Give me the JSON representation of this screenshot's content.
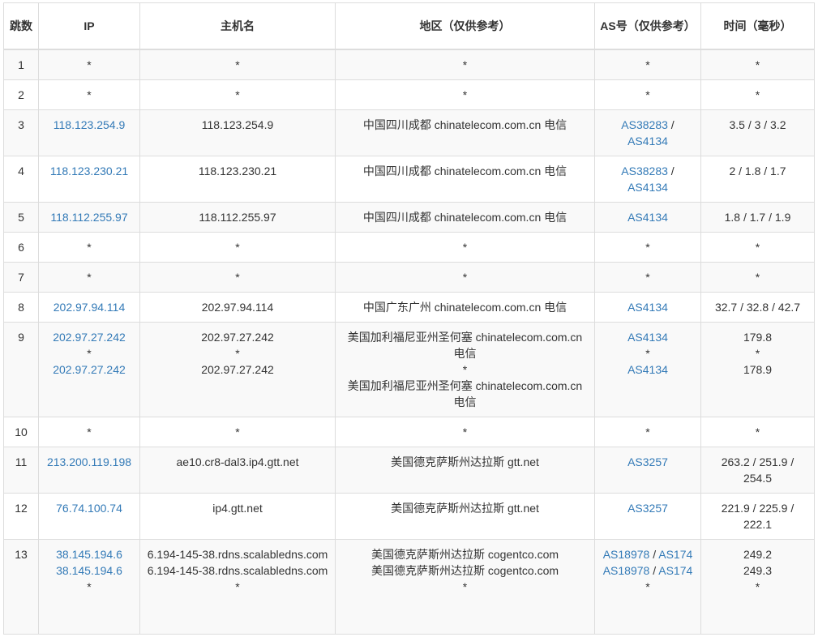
{
  "headers": {
    "hop": "跳数",
    "ip": "IP",
    "host": "主机名",
    "region": "地区（仅供参考）",
    "as": "AS号（仅供参考）",
    "time": "时间（毫秒）"
  },
  "rows": [
    {
      "hop": "1",
      "ip": [
        "*"
      ],
      "host": [
        "*"
      ],
      "region": [
        "*"
      ],
      "as": [
        "*"
      ],
      "time": [
        "*"
      ]
    },
    {
      "hop": "2",
      "ip": [
        "*"
      ],
      "host": [
        "*"
      ],
      "region": [
        "*"
      ],
      "as": [
        "*"
      ],
      "time": [
        "*"
      ]
    },
    {
      "hop": "3",
      "ip": [
        "118.123.254.9"
      ],
      "host": [
        "118.123.254.9"
      ],
      "region": [
        "中国四川成都 chinatelecom.com.cn 电信"
      ],
      "as": [
        "AS38283 / AS4134"
      ],
      "time": [
        "3.5 / 3 / 3.2"
      ]
    },
    {
      "hop": "4",
      "ip": [
        "118.123.230.21"
      ],
      "host": [
        "118.123.230.21"
      ],
      "region": [
        "中国四川成都 chinatelecom.com.cn 电信"
      ],
      "as": [
        "AS38283 / AS4134"
      ],
      "time": [
        "2 / 1.8 / 1.7"
      ]
    },
    {
      "hop": "5",
      "ip": [
        "118.112.255.97"
      ],
      "host": [
        "118.112.255.97"
      ],
      "region": [
        "中国四川成都 chinatelecom.com.cn 电信"
      ],
      "as": [
        "AS4134"
      ],
      "time": [
        "1.8 / 1.7 / 1.9"
      ]
    },
    {
      "hop": "6",
      "ip": [
        "*"
      ],
      "host": [
        "*"
      ],
      "region": [
        "*"
      ],
      "as": [
        "*"
      ],
      "time": [
        "*"
      ]
    },
    {
      "hop": "7",
      "ip": [
        "*"
      ],
      "host": [
        "*"
      ],
      "region": [
        "*"
      ],
      "as": [
        "*"
      ],
      "time": [
        "*"
      ]
    },
    {
      "hop": "8",
      "ip": [
        "202.97.94.114"
      ],
      "host": [
        "202.97.94.114"
      ],
      "region": [
        "中国广东广州 chinatelecom.com.cn 电信"
      ],
      "as": [
        "AS4134"
      ],
      "time": [
        "32.7 / 32.8 / 42.7"
      ]
    },
    {
      "hop": "9",
      "ip": [
        "202.97.27.242",
        "*",
        "202.97.27.242"
      ],
      "host": [
        "202.97.27.242",
        "*",
        "202.97.27.242"
      ],
      "region": [
        "美国加利福尼亚州圣何塞 chinatelecom.com.cn 电信",
        "*",
        "美国加利福尼亚州圣何塞 chinatelecom.com.cn 电信"
      ],
      "as": [
        "AS4134",
        "*",
        "AS4134"
      ],
      "time": [
        "179.8",
        "*",
        "178.9"
      ]
    },
    {
      "hop": "10",
      "ip": [
        "*"
      ],
      "host": [
        "*"
      ],
      "region": [
        "*"
      ],
      "as": [
        "*"
      ],
      "time": [
        "*"
      ]
    },
    {
      "hop": "11",
      "ip": [
        "213.200.119.198"
      ],
      "host": [
        "ae10.cr8-dal3.ip4.gtt.net"
      ],
      "region": [
        "美国德克萨斯州达拉斯 gtt.net"
      ],
      "as": [
        "AS3257"
      ],
      "time": [
        "263.2 / 251.9 / 254.5"
      ]
    },
    {
      "hop": "12",
      "ip": [
        "76.74.100.74"
      ],
      "host": [
        "ip4.gtt.net"
      ],
      "region": [
        "美国德克萨斯州达拉斯 gtt.net"
      ],
      "as": [
        "AS3257"
      ],
      "time": [
        "221.9 / 225.9 / 222.1"
      ]
    },
    {
      "hop": "13",
      "ip": [
        "38.145.194.6",
        "38.145.194.6",
        "*"
      ],
      "host": [
        "6.194-145-38.rdns.scalabledns.com",
        "6.194-145-38.rdns.scalabledns.com",
        "*"
      ],
      "region": [
        "美国德克萨斯州达拉斯 cogentco.com",
        "美国德克萨斯州达拉斯 cogentco.com",
        "*"
      ],
      "as": [
        "AS18978 / AS174",
        "AS18978 / AS174",
        "*"
      ],
      "time": [
        "249.2",
        "249.3",
        "*"
      ]
    }
  ],
  "colors": {
    "link": "#337ab7",
    "text": "#333333",
    "border": "#dddddd",
    "stripe": "#f9f9f9"
  }
}
